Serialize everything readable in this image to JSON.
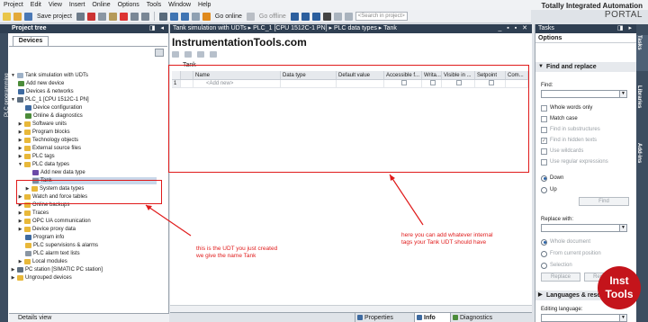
{
  "menu": [
    "Project",
    "Edit",
    "View",
    "Insert",
    "Online",
    "Options",
    "Tools",
    "Window",
    "Help"
  ],
  "brand": {
    "line1": "Totally Integrated Automation",
    "line2": "PORTAL"
  },
  "toolbar": {
    "save_project": "Save project",
    "go_online": "Go online",
    "go_offline": "Go offline",
    "search_placeholder": "<Search in project>"
  },
  "project_tree": {
    "title": "Project tree",
    "tab": "Devices",
    "side_tab": "PLC programming",
    "items": [
      "Tank simulation with UDTs",
      "Add new device",
      "Devices & networks",
      "PLC_1 [CPU 1512C-1 PN]",
      "Device configuration",
      "Online & diagnostics",
      "Software units",
      "Program blocks",
      "Technology objects",
      "External source files",
      "PLC tags",
      "PLC data types",
      "Add new data type",
      "Tank",
      "System data types",
      "Watch and force tables",
      "Online backups",
      "Traces",
      "OPC UA communication",
      "Device proxy data",
      "Program info",
      "PLC supervisions & alarms",
      "PLC alarm text lists",
      "Local modules",
      "PC station [SIMATIC PC station]",
      "Ungrouped devices"
    ],
    "details_view": "Details view"
  },
  "editor": {
    "breadcrumb": "Tank simulation with UDTs ▸ PLC_1 [CPU 1512C-1 PN] ▸ PLC data types ▸ Tank",
    "watermark": "InstrumentationTools.com",
    "block_name": "Tank",
    "columns": [
      "Name",
      "Data type",
      "Default value",
      "Accessible f...",
      "Writa...",
      "Visible in ...",
      "Setpoint",
      "Com..."
    ],
    "rows": [
      {
        "num": "1",
        "name": "<Add new>"
      }
    ]
  },
  "annotations": {
    "udt_note_line1": "this is the UDT you just created",
    "udt_note_line2": "we give the name Tank",
    "table_note_line1": "here you can add whatever internal",
    "table_note_line2": "tags your Tank UDT should have"
  },
  "status_tabs": {
    "properties": "Properties",
    "info": "Info",
    "diagnostics": "Diagnostics"
  },
  "tasks": {
    "title": "Tasks",
    "options": "Options",
    "find_replace": "Find and replace",
    "find_label": "Find:",
    "whole_words": "Whole words only",
    "match_case": "Match case",
    "find_substructures": "Find in substructures",
    "find_hidden": "Find in hidden texts",
    "use_wildcards": "Use wildcards",
    "use_regex": "Use regular expressions",
    "down": "Down",
    "up": "Up",
    "find_button": "Find",
    "replace_with": "Replace with:",
    "whole_document": "Whole document",
    "from_current": "From current position",
    "selection": "Selection",
    "replace_button": "Replace",
    "replace_all_button": "Replace all",
    "languages": "Languages & resources",
    "editing_language": "Editing language:"
  },
  "right_tabs": [
    "Tasks",
    "Libraries",
    "Add-ins"
  ],
  "logo": {
    "line1": "Inst",
    "line2": "Tools"
  },
  "colors": {
    "header_dark": "#2f3f52",
    "annotation_red": "#e01b1b",
    "logo_red": "#c4141b"
  }
}
